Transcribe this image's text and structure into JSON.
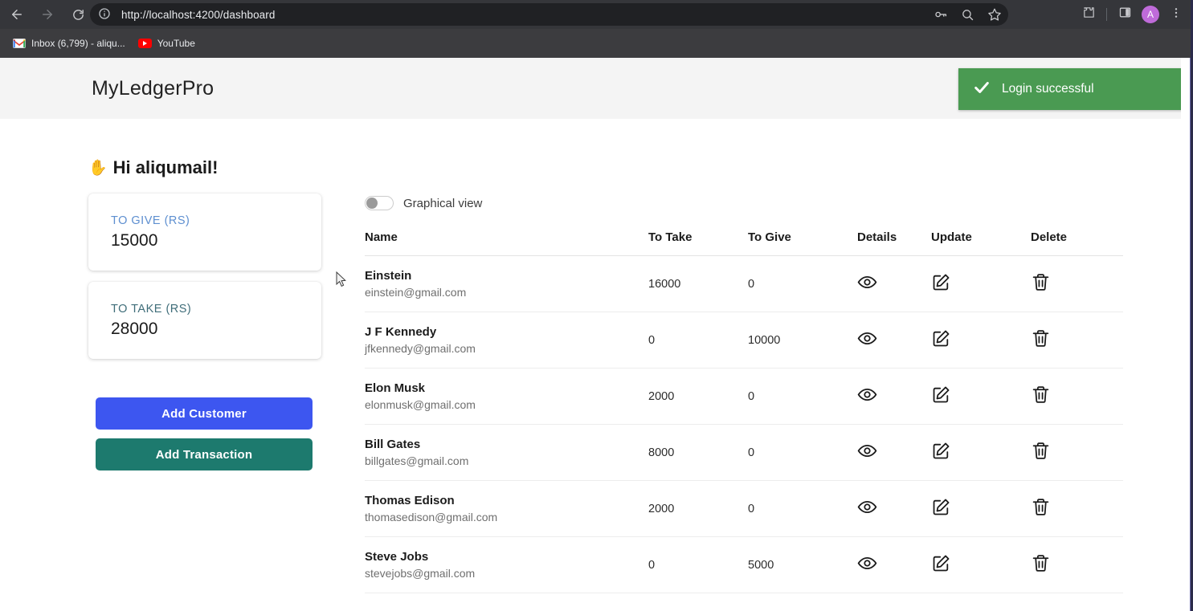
{
  "browser": {
    "back_icon": "back-arrow-icon",
    "forward_icon": "forward-arrow-icon",
    "reload_icon": "reload-icon",
    "site_info_icon": "site-info-icon",
    "url": "http://localhost:4200/dashboard",
    "omnibox_actions": [
      "password-key-icon",
      "search-icon",
      "bookmark-star-icon"
    ],
    "toolbar_actions": [
      "extensions-puzzle-icon",
      "side-panel-icon"
    ],
    "profile_initial": "A",
    "menu_icon": "three-dot-menu-icon",
    "bookmarks": [
      {
        "label": "Inbox (6,799) - aliqu...",
        "icon": "gmail-icon"
      },
      {
        "label": "YouTube",
        "icon": "youtube-icon"
      }
    ]
  },
  "toast": {
    "message": "Login successful",
    "icon": "checkmark-icon",
    "color": "#4a9a52"
  },
  "app": {
    "brand": "MyLedgerPro",
    "greeting": "Hi aliqumail!",
    "greeting_emoji": "✋"
  },
  "stats": [
    {
      "label": "TO GIVE (RS)",
      "value": "15000",
      "color": "#5e8fd0"
    },
    {
      "label": "TO TAKE (RS)",
      "value": "28000",
      "color": "#3f6d79"
    }
  ],
  "actions": {
    "add_customer": "Add Customer",
    "add_customer_color": "#3d56f0",
    "add_transaction": "Add Transaction",
    "add_transaction_color": "#1d7a6e"
  },
  "view_toggle": {
    "label": "Graphical view",
    "checked": false
  },
  "table": {
    "headers": [
      "Name",
      "To Take",
      "To Give",
      "Details",
      "Update",
      "Delete"
    ],
    "rows": [
      {
        "name": "Einstein",
        "email": "einstein@gmail.com",
        "to_take": "16000",
        "to_give": "0"
      },
      {
        "name": "J F Kennedy",
        "email": "jfkennedy@gmail.com",
        "to_take": "0",
        "to_give": "10000"
      },
      {
        "name": "Elon Musk",
        "email": "elonmusk@gmail.com",
        "to_take": "2000",
        "to_give": "0"
      },
      {
        "name": "Bill Gates",
        "email": "billgates@gmail.com",
        "to_take": "8000",
        "to_give": "0"
      },
      {
        "name": "Thomas Edison",
        "email": "thomasedison@gmail.com",
        "to_take": "2000",
        "to_give": "0"
      },
      {
        "name": "Steve Jobs",
        "email": "stevejobs@gmail.com",
        "to_take": "0",
        "to_give": "5000"
      }
    ],
    "row_icons": {
      "details": "eye-icon",
      "update": "pencil-square-icon",
      "delete": "trash-icon"
    }
  }
}
